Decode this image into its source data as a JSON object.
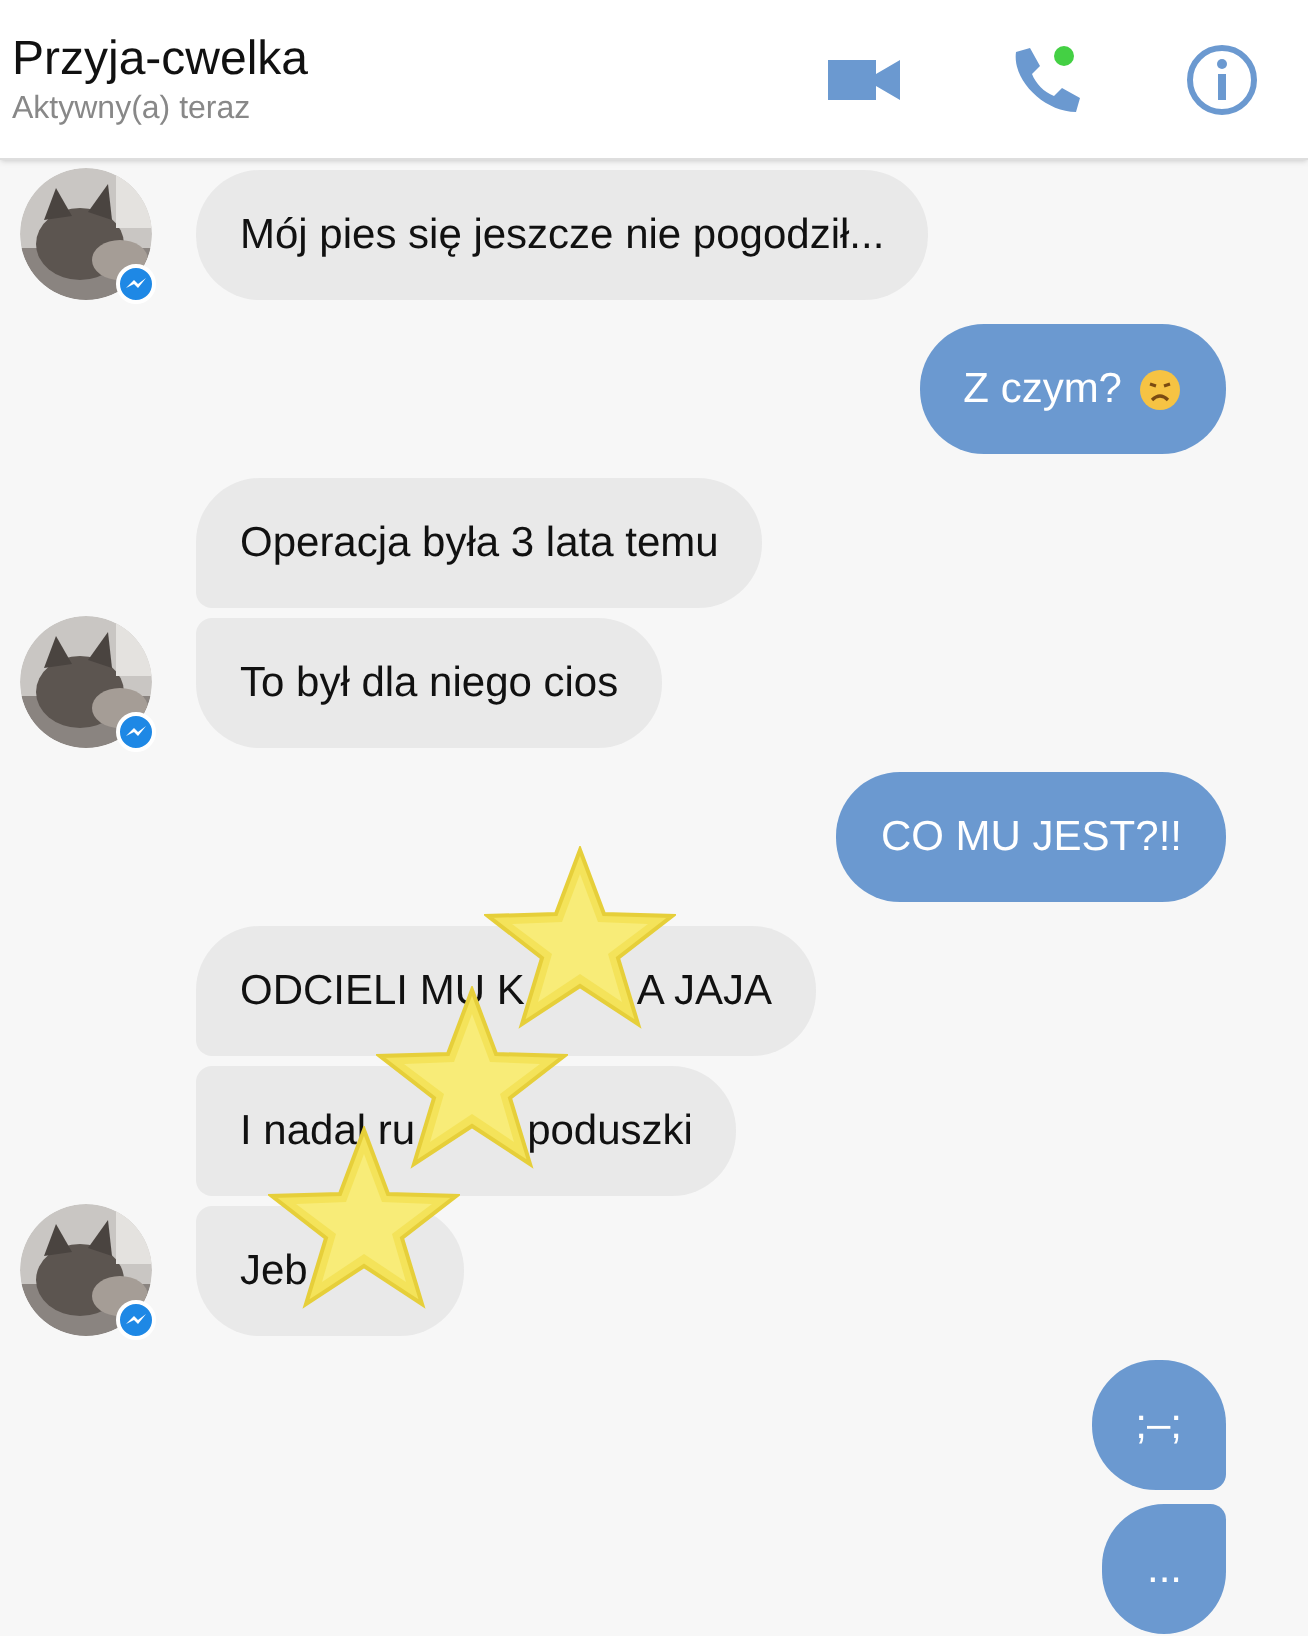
{
  "header": {
    "title": "Przyja-cwelka",
    "status": "Aktywny(a) teraz"
  },
  "groups": [
    {
      "kind": "incoming",
      "messages": [
        {
          "segments": [
            {
              "kind": "text",
              "text": "Mój pies się jeszcze nie pogodził..."
            }
          ]
        }
      ]
    },
    {
      "kind": "outgoing",
      "messages": [
        {
          "segments": [
            {
              "kind": "text",
              "text": "Z czym?"
            },
            {
              "kind": "emoji"
            }
          ]
        }
      ]
    },
    {
      "kind": "incoming",
      "messages": [
        {
          "segments": [
            {
              "kind": "text",
              "text": "Operacja była 3 lata temu"
            }
          ]
        },
        {
          "segments": [
            {
              "kind": "text",
              "text": "To był dla niego cios"
            }
          ]
        }
      ]
    },
    {
      "kind": "outgoing",
      "messages": [
        {
          "segments": [
            {
              "kind": "text",
              "text": "CO MU JEST?!!"
            }
          ]
        }
      ]
    },
    {
      "kind": "incoming",
      "messages": [
        {
          "segments": [
            {
              "kind": "text",
              "text": "ODCIELI MU K"
            },
            {
              "kind": "sticker"
            },
            {
              "kind": "text",
              "text": "A JAJA"
            }
          ]
        },
        {
          "segments": [
            {
              "kind": "text",
              "text": "I nadal ru"
            },
            {
              "kind": "sticker"
            },
            {
              "kind": "text",
              "text": "poduszki"
            }
          ]
        },
        {
          "segments": [
            {
              "kind": "text",
              "text": "Jeb"
            },
            {
              "kind": "sticker"
            }
          ]
        }
      ]
    },
    {
      "kind": "outgoing",
      "messages": [
        {
          "segments": [
            {
              "kind": "text",
              "text": ";–;"
            }
          ]
        },
        {
          "segments": [
            {
              "kind": "text",
              "text": "..."
            }
          ]
        }
      ]
    }
  ]
}
